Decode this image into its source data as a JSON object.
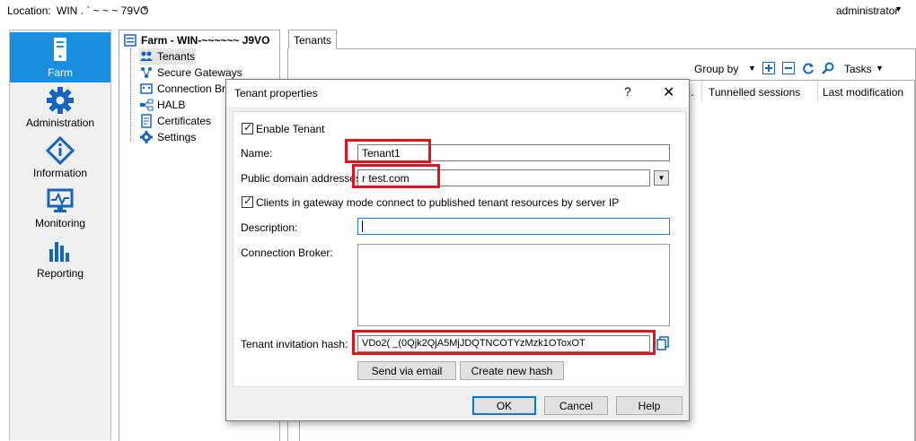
{
  "topbar": {
    "location_label": "Location:",
    "location_value": "WIN .  ` ~ ~ ~ 79VO",
    "user": "administrator"
  },
  "nav": [
    {
      "label": "Farm",
      "icon": "server-icon",
      "active": true
    },
    {
      "label": "Administration",
      "icon": "gear-icon"
    },
    {
      "label": "Information",
      "icon": "info-icon"
    },
    {
      "label": "Monitoring",
      "icon": "monitor-icon"
    },
    {
      "label": "Reporting",
      "icon": "bar-chart-icon"
    }
  ],
  "tree": {
    "root": "Farm - WIN-~~~~~~ J9VO",
    "items": [
      "Tenants",
      "Secure Gateways",
      "Connection Brokers",
      "HALB",
      "Certificates",
      "Settings"
    ]
  },
  "tab": "Tenants",
  "toolbar": {
    "group_by": "Group by",
    "tasks": "Tasks",
    "icons": [
      "add-icon",
      "remove-icon",
      "refresh-icon",
      "search-icon"
    ]
  },
  "grid": {
    "stub": "..",
    "columns": [
      "Tunnelled sessions",
      "Last modification"
    ]
  },
  "dialog": {
    "title": "Tenant properties",
    "help": "?",
    "close": "✕",
    "enable_tenant": "Enable Tenant",
    "name_label": "Name:",
    "name_value": "Tenant1",
    "domain_label": "Public domain addresses:",
    "domain_value": "r         test.com",
    "gateway_mode_label": "Clients in gateway mode connect to published tenant resources by server IP",
    "description_label": "Description:",
    "broker_label": "Connection Broker:",
    "hash_label": "Tenant invitation hash:",
    "hash_value": "VDo2(         _(0Qjk2QjA5MjJDQTNCOTYzMzk1OToxOT",
    "send_email": "Send via email",
    "create_hash": "Create new hash",
    "ok": "OK",
    "cancel": "Cancel",
    "help_button": "Help"
  },
  "colors": {
    "accent": "#1a8fe0",
    "highlight_box": "#e0141e",
    "icon_blue": "#1565c0"
  }
}
